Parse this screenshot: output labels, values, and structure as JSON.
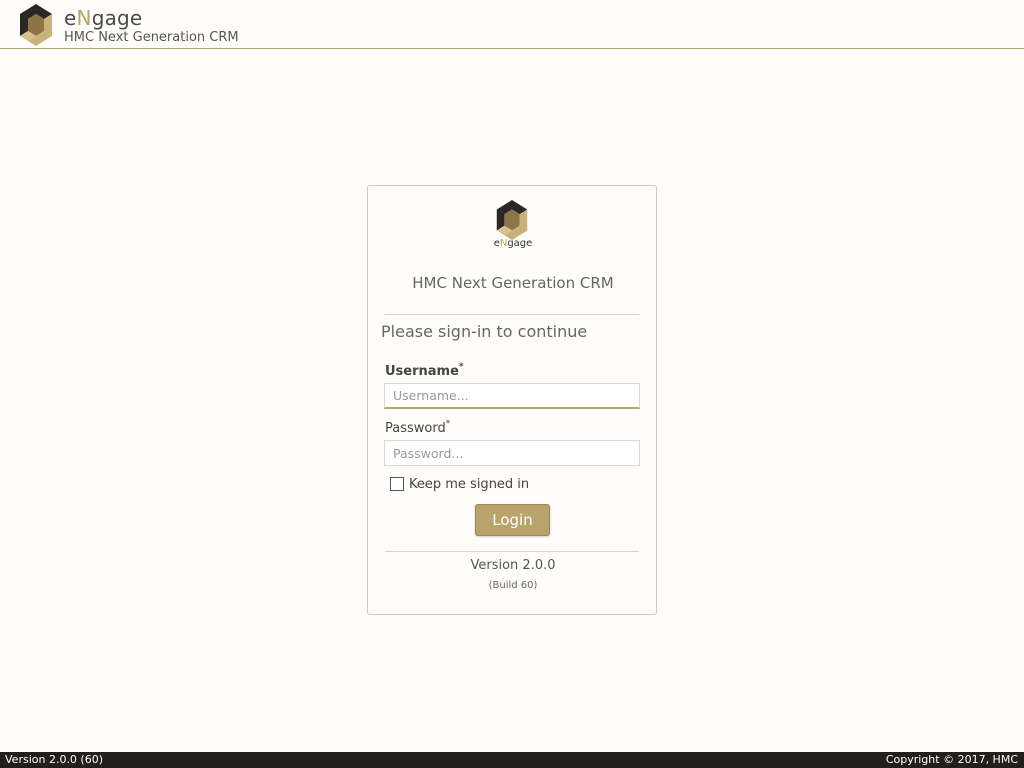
{
  "header": {
    "brand_prefix": "e",
    "brand_highlight": "N",
    "brand_suffix": "gage",
    "subtitle": "HMC Next Generation CRM",
    "logo_icon": "engage-logo-icon"
  },
  "login_card": {
    "logo_prefix": "e",
    "logo_highlight": "N",
    "logo_suffix": "gage",
    "title": "HMC Next Generation CRM",
    "prompt": "Please sign-in to continue",
    "username": {
      "label": "Username",
      "required_mark": "*",
      "placeholder": "Username...",
      "value": ""
    },
    "password": {
      "label": "Password",
      "required_mark": "*",
      "placeholder": "Password...",
      "value": ""
    },
    "keep_signed_in": {
      "label": "Keep me signed in",
      "checked": false
    },
    "login_button": "Login",
    "version": "Version 2.0.0",
    "build": "(Build 60)"
  },
  "footer": {
    "version": "Version 2.0.0 (60)",
    "copyright": "Copyright © 2017, HMC"
  },
  "colors": {
    "accent": "#b8a36a",
    "background": "#fffdfa",
    "footer_bg": "#231f1b"
  }
}
